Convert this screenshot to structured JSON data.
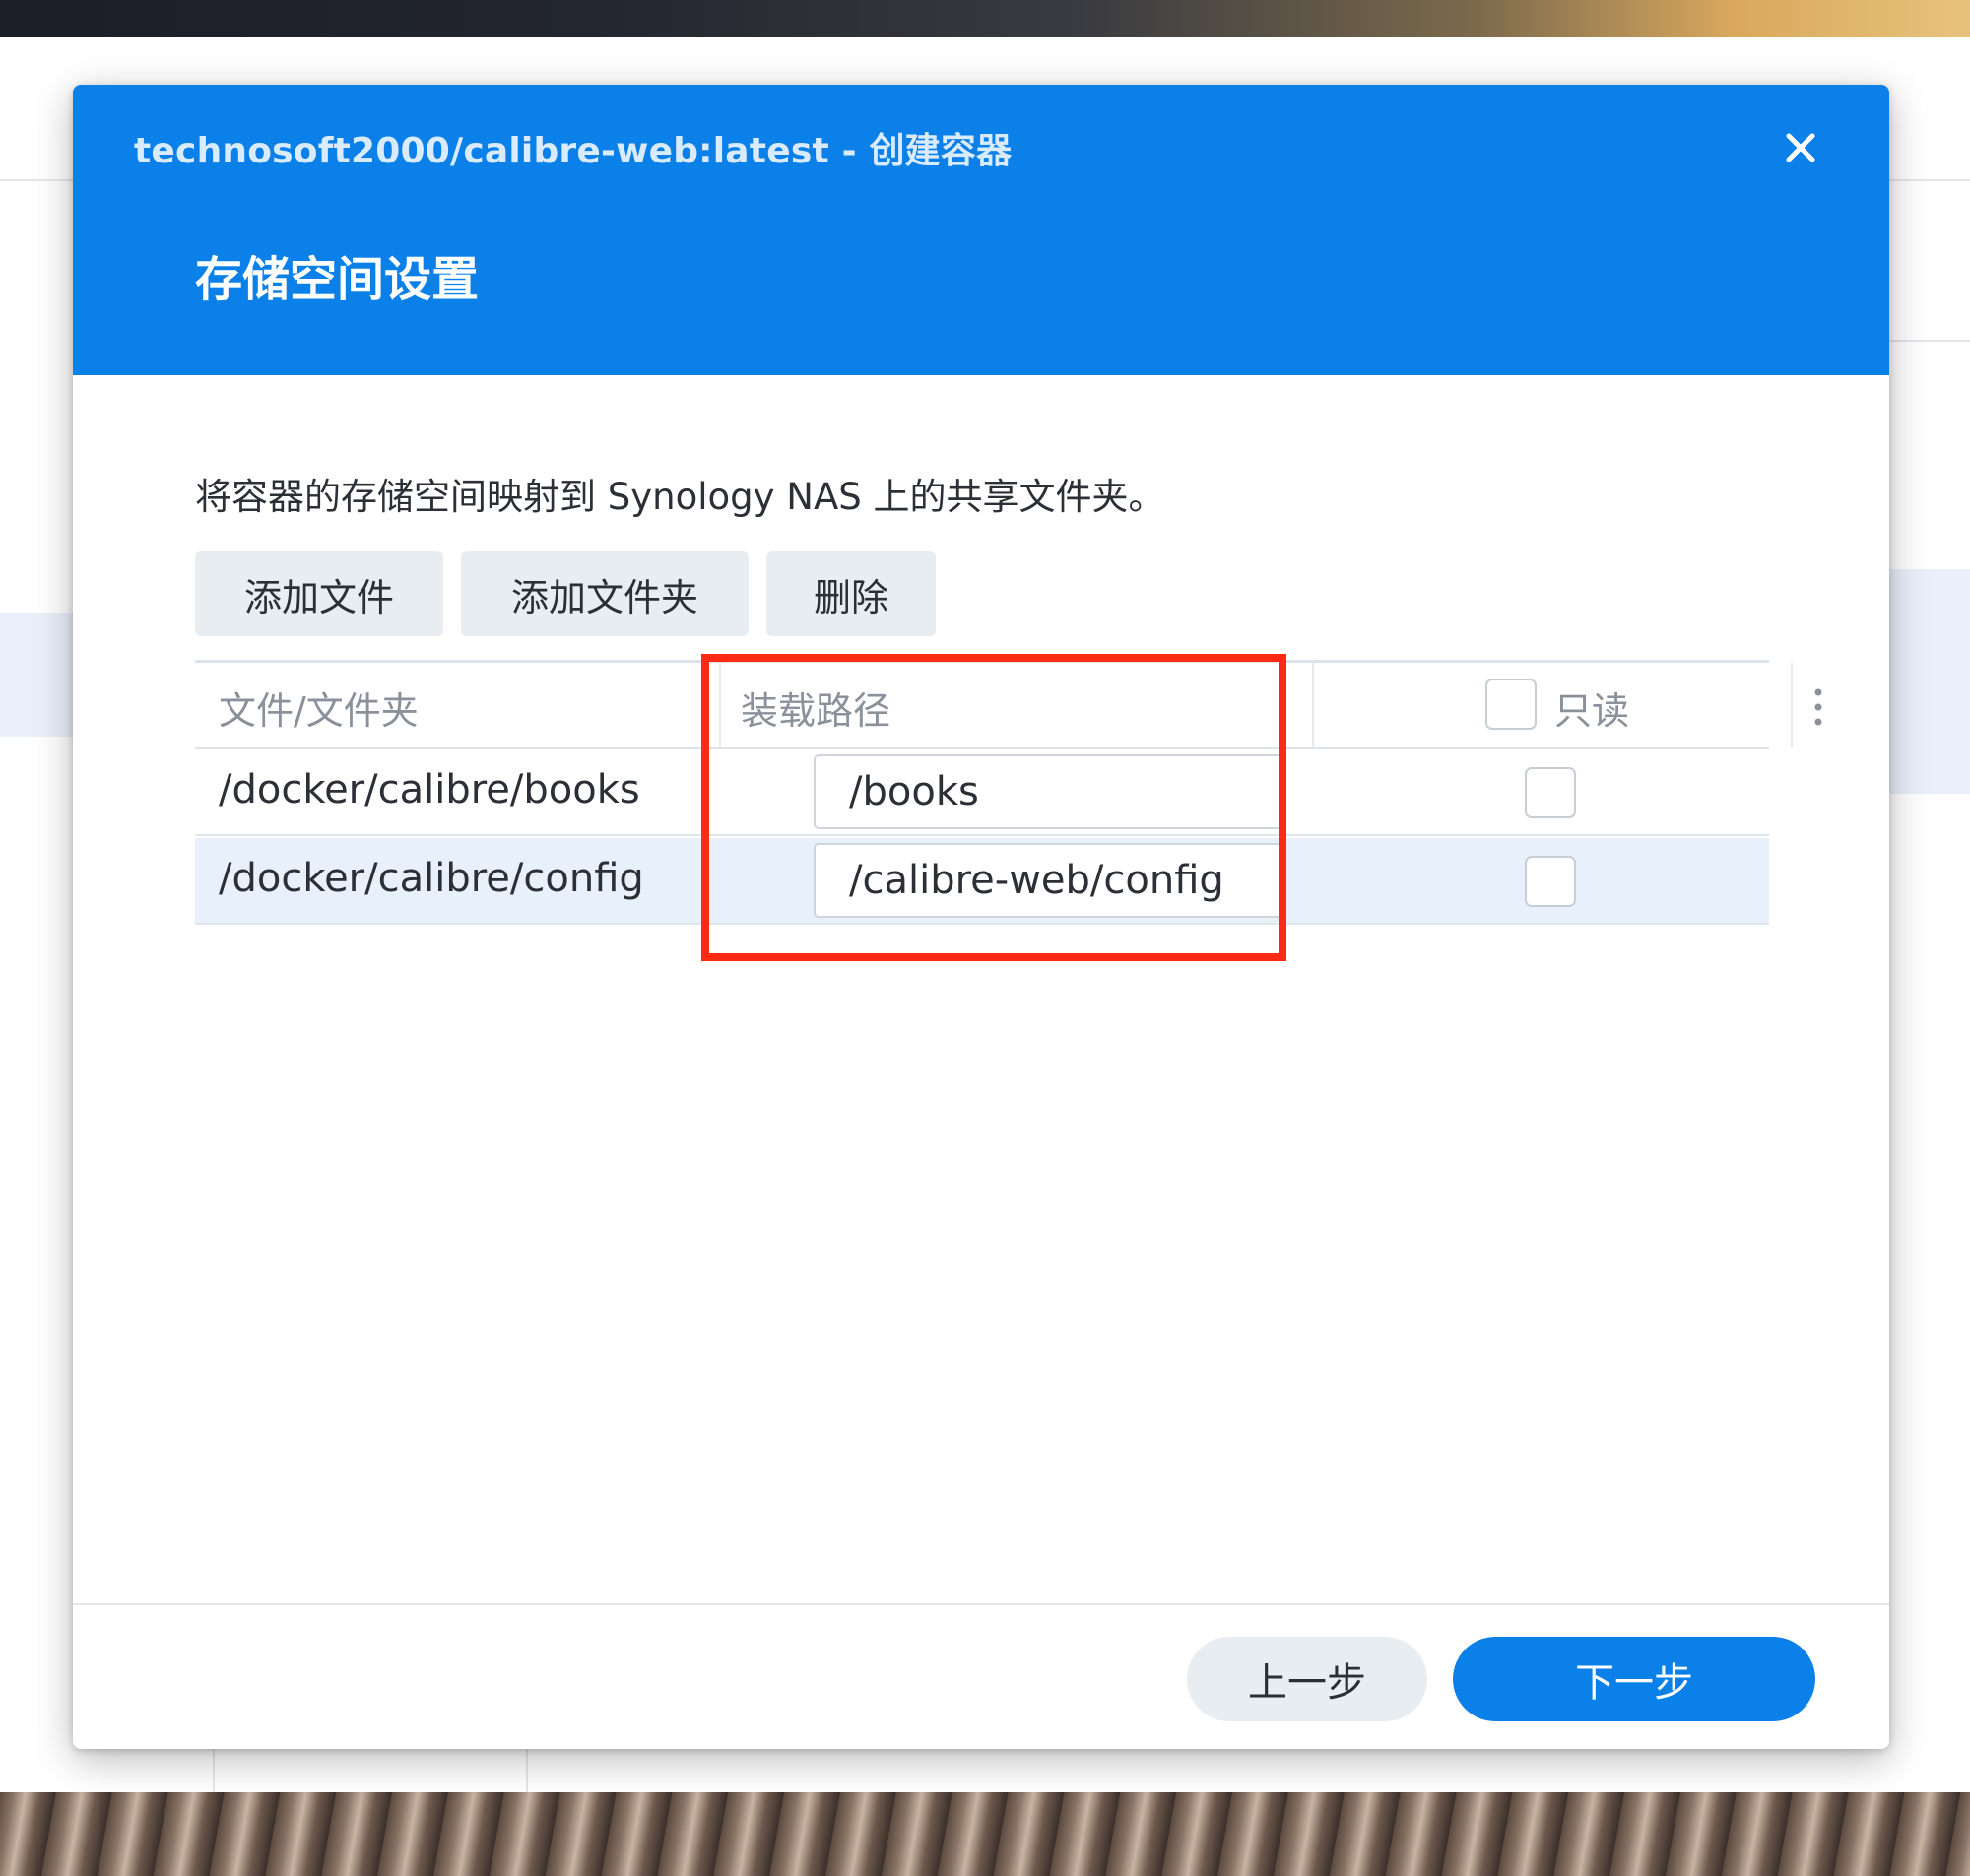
{
  "dialog": {
    "title": "technosoft2000/calibre-web:latest - 创建容器",
    "subtitle": "存储空间设置",
    "description": "将容器的存储空间映射到 Synology NAS 上的共享文件夹。"
  },
  "toolbar": {
    "add_file_label": "添加文件",
    "add_folder_label": "添加文件夹",
    "delete_label": "删除"
  },
  "table": {
    "columns": {
      "file_folder": "文件/文件夹",
      "mount_path": "装载路径",
      "read_only": "只读"
    },
    "rows": [
      {
        "path": "/docker/calibre/books",
        "mount_path": "/books",
        "read_only": false
      },
      {
        "path": "/docker/calibre/config",
        "mount_path": "/calibre-web/config",
        "read_only": false
      }
    ]
  },
  "footer": {
    "prev_label": "上一步",
    "next_label": "下一步"
  },
  "colors": {
    "header_blue": "#0b80e8",
    "highlight_red": "#ff2a14",
    "selected_row": "#e8f0fb"
  },
  "icons": {
    "close": "close-icon",
    "column_menu": "vertical-dots-icon"
  }
}
